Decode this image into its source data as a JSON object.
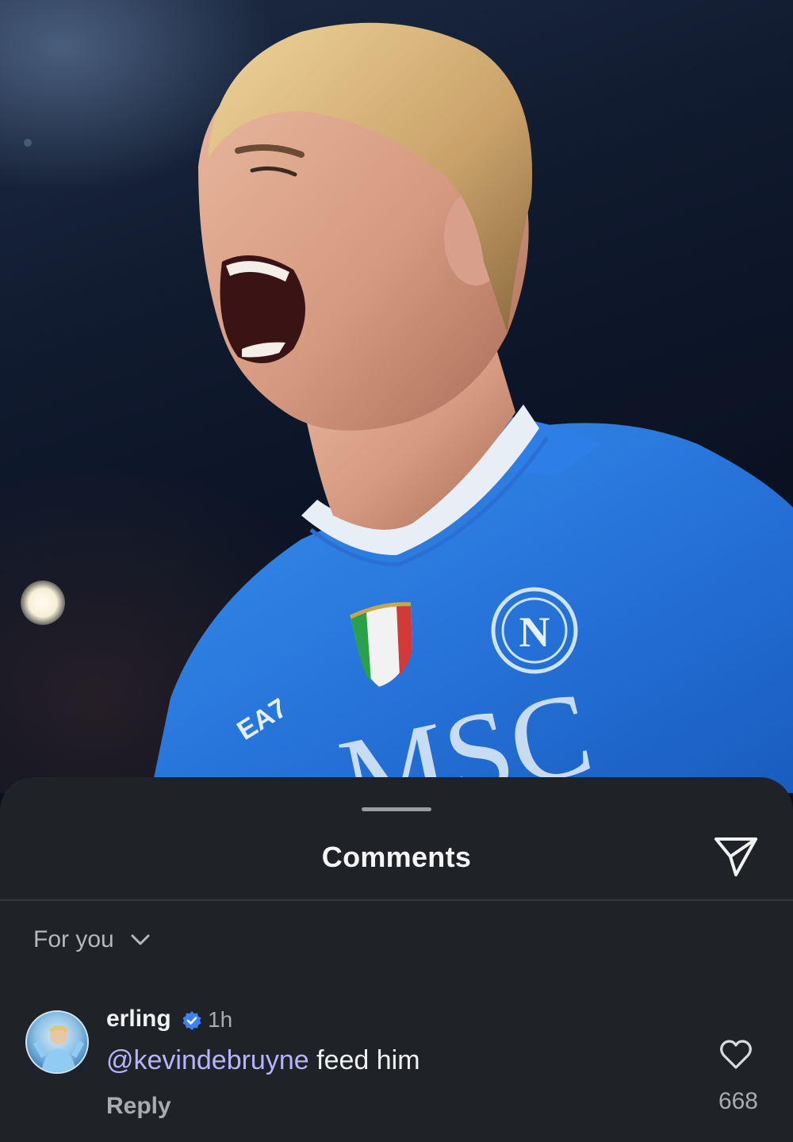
{
  "post_image": {
    "icon": "athlete-photo"
  },
  "comments_sheet": {
    "title": "Comments",
    "share_icon": "send-icon",
    "filter": {
      "label": "For you",
      "icon": "chevron-down-icon"
    }
  },
  "comment": {
    "username": "erling",
    "verified_icon": "verified-badge-icon",
    "time": "1h",
    "mention": "@kevindebruyne",
    "text": " feed him",
    "reply_label": "Reply",
    "like_icon": "heart-icon",
    "like_count": "668"
  },
  "colors": {
    "sheet_bg": "#1f2226",
    "mention": "#b9b3ff",
    "verified": "#3b82f6",
    "jersey": "#2f7fe0"
  }
}
